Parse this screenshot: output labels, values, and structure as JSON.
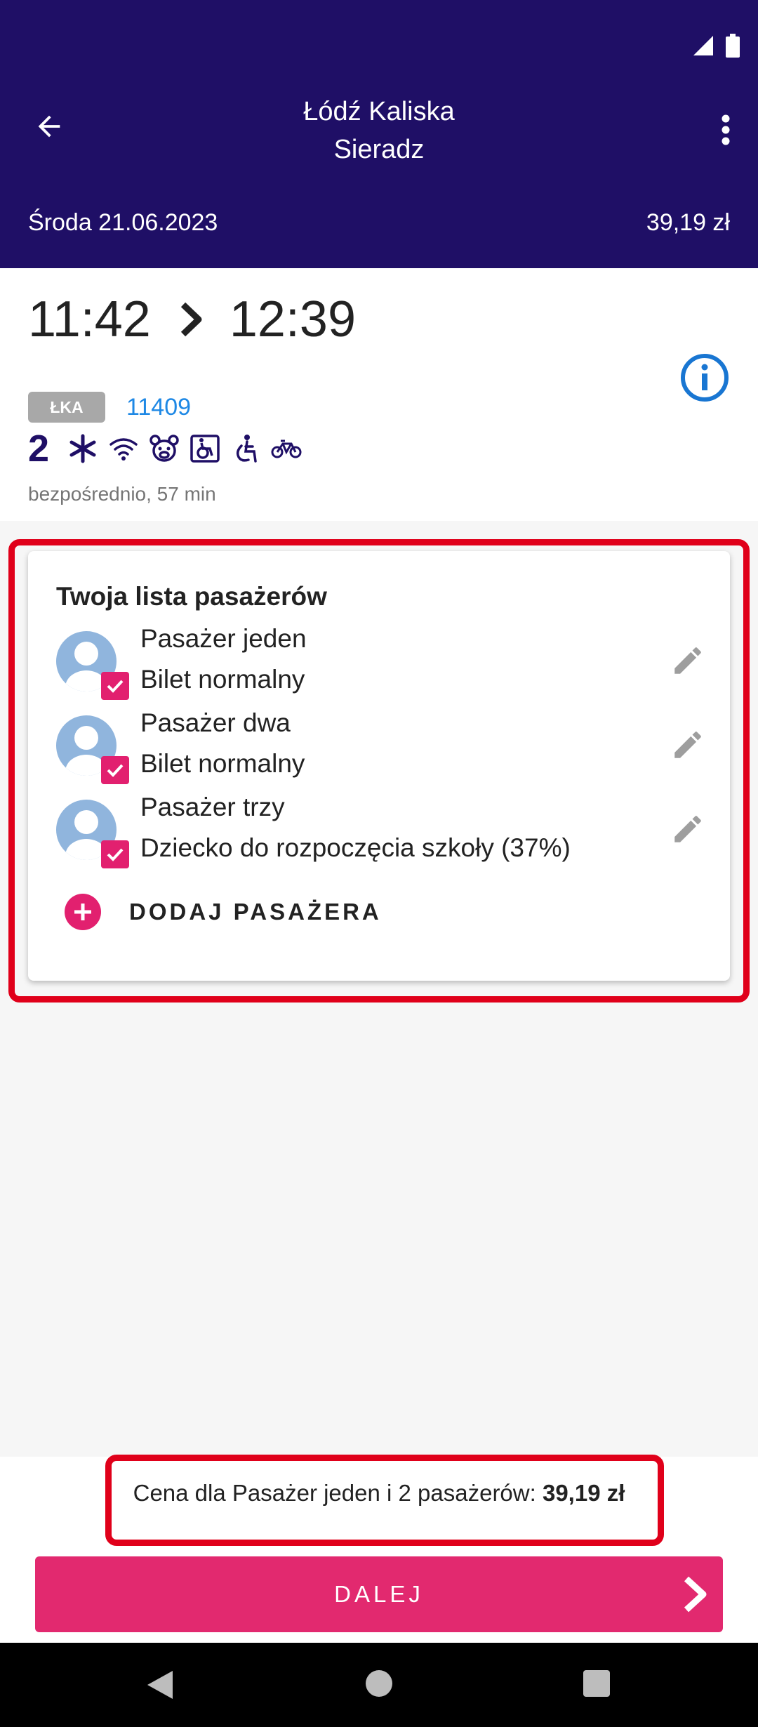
{
  "header": {
    "route_from": "Łódź Kaliska",
    "route_to": "Sieradz",
    "date": "Środa 21.06.2023",
    "price": "39,19 zł"
  },
  "journey": {
    "departure": "11:42",
    "arrival": "12:39",
    "carrier": "ŁKA",
    "train_number": "11409",
    "class": "2",
    "amenity_icons": [
      "air-conditioning-icon",
      "wifi-icon",
      "child-area-icon",
      "wheelchair-space-icon",
      "accessible-toilet-icon",
      "bicycle-icon"
    ],
    "summary": "bezpośrednio, 57 min"
  },
  "passengers": {
    "title": "Twoja lista pasażerów",
    "items": [
      {
        "name": "Pasażer jeden",
        "ticket": "Bilet normalny",
        "checked": true
      },
      {
        "name": "Pasażer dwa",
        "ticket": "Bilet normalny",
        "checked": true
      },
      {
        "name": "Pasażer trzy",
        "ticket": "Dziecko do rozpoczęcia szkoły (37%)",
        "checked": true
      }
    ],
    "add_label": "DODAJ PASAŻERA"
  },
  "footer": {
    "price_prefix": "Cena dla Pasażer jeden i 2 pasażerów: ",
    "price_value": "39,19 zł",
    "next_label": "DALEJ"
  },
  "colors": {
    "header_bg": "#1f0f66",
    "accent": "#e2296f",
    "link": "#1e88e5",
    "highlight": "#e0001a"
  }
}
